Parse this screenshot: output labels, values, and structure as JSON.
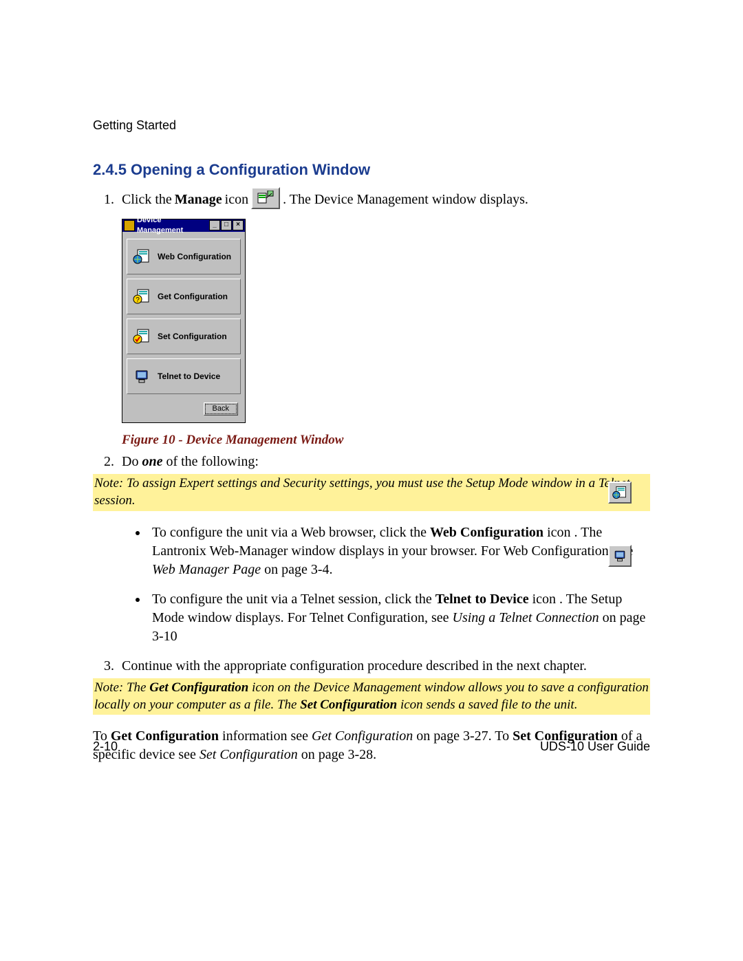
{
  "header": {
    "chapter": "Getting Started"
  },
  "section": {
    "number_title": "2.4.5 Opening a Configuration Window"
  },
  "step1": {
    "pre": "Click the ",
    "bold": "Manage",
    "mid": " icon ",
    "post": ". The Device Management window displays."
  },
  "manage_icon_name": "manage-icon",
  "dm_window": {
    "title": "Device Management",
    "items": [
      {
        "label": "Web Configuration",
        "icon": "globe-doc-icon"
      },
      {
        "label": "Get Configuration",
        "icon": "question-doc-icon"
      },
      {
        "label": "Set Configuration",
        "icon": "check-doc-icon"
      },
      {
        "label": "Telnet to Device",
        "icon": "terminal-icon"
      }
    ],
    "back": "Back"
  },
  "figure_caption": "Figure 10 - Device Management Window",
  "step2": {
    "pre": "Do ",
    "bold": "one",
    "post": " of the following:"
  },
  "note1": "Note: To assign Expert settings and Security settings, you must use the Setup Mode window in a Telnet session.",
  "bullets": [
    {
      "pre": "To configure the unit via a Web browser, click the ",
      "bold": "Web Configuration",
      "mid": " icon ",
      "post1": ". The Lantronix Web-Manager window displays in your browser. For Web Configuration, see ",
      "ref_italic": "Web Manager Page",
      "post2": " on page 3-4.",
      "icon": "globe-doc-icon"
    },
    {
      "pre": "To configure the unit via a Telnet session, click the ",
      "bold": "Telnet to Device",
      "mid": " icon ",
      "post1": ". The Setup Mode window displays. For Telnet Configuration, see ",
      "ref_italic": "Using a Telnet Connection",
      "post2": " on page 3-10",
      "icon": "terminal-icon"
    }
  ],
  "step3": "Continue with the appropriate configuration procedure described in the next chapter.",
  "note2": {
    "p1a": "Note: The ",
    "b1": "Get Configuration",
    "p1b": " icon on the Device Management window allows you to save a configuration locally on your computer as a file. The ",
    "b2": "Set Configuration",
    "p1c": " icon sends a saved file to the unit."
  },
  "trailing": {
    "t1": "To ",
    "b1": "Get Configuration",
    "t2": " information see ",
    "i1": "Get Configuration",
    "t3": " on page 3-27. To ",
    "b2": "Set Configuration",
    "t4": " of a specific device see ",
    "i2": "Set Configuration",
    "t5": " on page 3-28."
  },
  "footer": {
    "page": "2-10",
    "doc": "UDS-10 User Guide"
  },
  "colors": {
    "heading": "#1b3c8f",
    "caption": "#7a1a14",
    "note_bg": "#fff29a"
  }
}
